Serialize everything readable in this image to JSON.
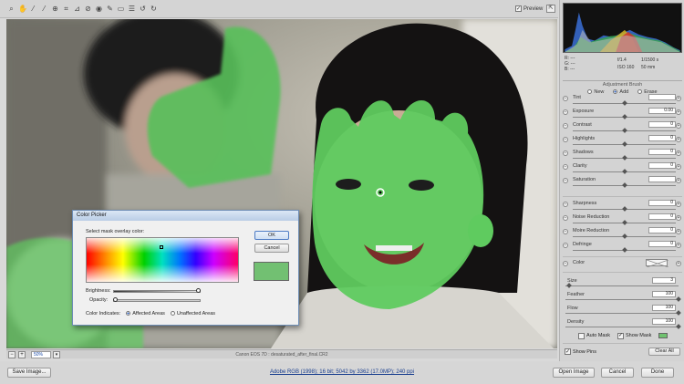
{
  "toolbar": {
    "tools": [
      "zoom-icon",
      "hand-icon",
      "white-balance-icon",
      "color-sampler-icon",
      "targeted-adjustment-icon",
      "crop-icon",
      "straighten-icon",
      "spot-removal-icon",
      "red-eye-icon",
      "adjustment-brush-icon",
      "graduated-filter-icon",
      "preferences-icon",
      "rotate-ccw-icon",
      "rotate-cw-icon"
    ],
    "preview_label": "Preview",
    "preview_checked": true
  },
  "histogram": {
    "rgb": {
      "r_label": "R:",
      "g_label": "G:",
      "b_label": "B:",
      "r": "---",
      "g": "---",
      "b": "---"
    },
    "exposure_info": {
      "aperture": "f/1.4",
      "shutter": "1/1500 s",
      "iso": "ISO 160",
      "focal": "50 mm"
    }
  },
  "adjustment_brush": {
    "title": "Adjustment Brush",
    "modes": [
      {
        "label": "New",
        "selected": false
      },
      {
        "label": "Add",
        "selected": true
      },
      {
        "label": "Erase",
        "selected": false
      }
    ],
    "sliders_group1": [
      {
        "label": "Tint",
        "value": "",
        "pos": 0.5
      },
      {
        "label": "Exposure",
        "value": "0.00",
        "pos": 0.5
      },
      {
        "label": "Contrast",
        "value": "0",
        "pos": 0.5
      },
      {
        "label": "Highlights",
        "value": "0",
        "pos": 0.5
      },
      {
        "label": "Shadows",
        "value": "0",
        "pos": 0.5
      },
      {
        "label": "Clarity",
        "value": "0",
        "pos": 0.5
      },
      {
        "label": "Saturation",
        "value": "",
        "pos": 0.5
      }
    ],
    "sliders_group2": [
      {
        "label": "Sharpness",
        "value": "0",
        "pos": 0.5
      },
      {
        "label": "Noise Reduction",
        "value": "0",
        "pos": 0.5
      },
      {
        "label": "Moire Reduction",
        "value": "0",
        "pos": 0.5
      },
      {
        "label": "Defringe",
        "value": "0",
        "pos": 0.5
      }
    ],
    "color_label": "Color",
    "brush": [
      {
        "label": "Size",
        "value": "3",
        "pos": 0.03
      },
      {
        "label": "Feather",
        "value": "100",
        "pos": 1
      },
      {
        "label": "Flow",
        "value": "100",
        "pos": 1
      },
      {
        "label": "Density",
        "value": "100",
        "pos": 1
      }
    ],
    "auto_mask_label": "Auto Mask",
    "auto_mask_checked": false,
    "show_mask_label": "Show Mask",
    "show_mask_checked": true,
    "mask_color": "#6fc26f",
    "show_pins_label": "Show Pins",
    "show_pins_checked": true,
    "clear_all_label": "Clear All"
  },
  "status": {
    "zoom": "50%",
    "camera_file": "Canon EOS 7D  :  desaturated_after_final.CR2"
  },
  "bottom": {
    "save_image_label": "Save Image...",
    "workflow_text": "Adobe RGB (1998); 16 bit; 5042 by 3362 (17.0MP); 240 ppi",
    "open_image_label": "Open Image",
    "cancel_label": "Cancel",
    "done_label": "Done"
  },
  "color_picker": {
    "title": "Color Picker",
    "prompt": "Select mask overlay color:",
    "ok_label": "OK",
    "cancel_label": "Cancel",
    "selected_color": "#72c072",
    "brightness_label": "Brightness:",
    "brightness": 0.97,
    "opacity_label": "Opacity:",
    "opacity": 0.02,
    "indicates_label": "Color Indicates:",
    "affected_label": "Affected Areas",
    "affected_selected": true,
    "unaffected_label": "Unaffected Areas",
    "unaffected_selected": false
  }
}
